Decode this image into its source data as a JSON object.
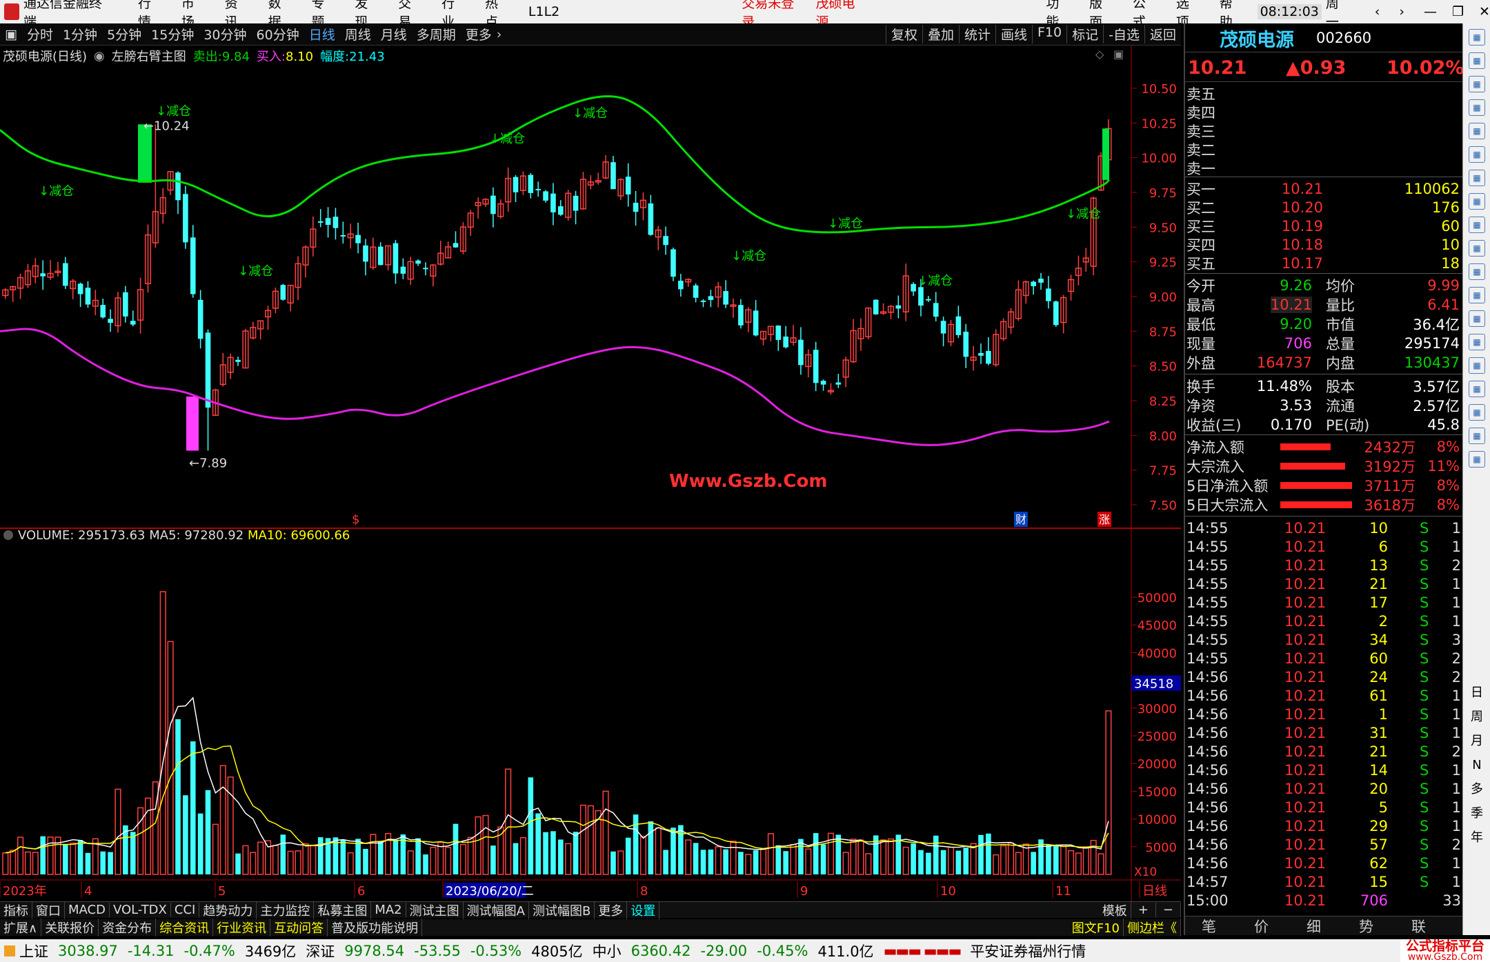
{
  "app": {
    "name": "通达信金融终端",
    "menus": [
      "行情",
      "市场",
      "资讯",
      "数据",
      "专题",
      "发现",
      "交易",
      "行业",
      "热点",
      "L1L2"
    ],
    "login": "交易未登录",
    "stock_title": "茂硕电源",
    "right_menus": [
      "功能",
      "版面",
      "公式",
      "选项",
      "帮助"
    ],
    "time": "08:12:03",
    "weekday": "周一"
  },
  "toolbar": {
    "periods": [
      "分时",
      "1分钟",
      "5分钟",
      "15分钟",
      "30分钟",
      "60分钟",
      "日线",
      "周线",
      "月线",
      "多周期",
      "更多"
    ],
    "selected": "日线",
    "right": [
      "复权",
      "叠加",
      "统计",
      "画线",
      "F10",
      "标记",
      "-自选",
      "返回"
    ]
  },
  "chart_info": {
    "stock": "茂硕电源(日线)",
    "main_indicator": "左膀右臂主图",
    "sell_label": "卖出:",
    "sell_value": "9.84",
    "buy_label": "买入:",
    "buy_value": "8.10",
    "range_label": "幅度:",
    "range_value": "21.43"
  },
  "price_axis": [
    "10.50",
    "10.25",
    "10.00",
    "9.75",
    "9.50",
    "9.25",
    "9.00",
    "8.75",
    "8.50",
    "8.25",
    "8.00",
    "7.75",
    "7.50"
  ],
  "price_annotations": {
    "high": "10.24",
    "low": "7.89",
    "reduce": "↓减仓",
    "watermark": "Www.Gszb.Com",
    "markers": [
      "$",
      "财",
      "涨"
    ]
  },
  "volume_info": {
    "label": "VOLUME: 295173.63",
    "ma5": "MA5: 97280.92",
    "ma10": "MA10: 69600.66",
    "cursor": "34518",
    "unit": "X10"
  },
  "volume_axis": [
    "50000",
    "45000",
    "40000",
    "35000",
    "30000",
    "25000",
    "20000",
    "15000",
    "10000",
    "5000"
  ],
  "date_axis": [
    "2023年",
    "4",
    "5",
    "6",
    "2023/06/20/二",
    "8",
    "9",
    "10",
    "11",
    "日线"
  ],
  "bottom_tabs": [
    "指标",
    "窗口",
    "MACD",
    "VOL-TDX",
    "CCI",
    "趋势动力",
    "主力监控",
    "私募主图",
    "MA2",
    "测试主图",
    "测试幅图A",
    "测试幅图B",
    "更多",
    "设置",
    "模板"
  ],
  "bottom_tabs2": [
    "扩展∧",
    "关联报价",
    "资金分布",
    "综合资讯",
    "行业资讯",
    "互动问答",
    "普及版功能说明"
  ],
  "bottom_right": [
    "图文F10",
    "侧边栏《"
  ],
  "quote": {
    "name": "茂硕电源",
    "code": "002660",
    "price": "10.21",
    "change": "▲0.93",
    "pct": "10.02%",
    "asks": [
      "卖五",
      "卖四",
      "卖三",
      "卖二",
      "卖一"
    ],
    "bids": [
      {
        "l": "买一",
        "p": "10.21",
        "v": "110062"
      },
      {
        "l": "买二",
        "p": "10.20",
        "v": "176"
      },
      {
        "l": "买三",
        "p": "10.19",
        "v": "60"
      },
      {
        "l": "买四",
        "p": "10.18",
        "v": "10"
      },
      {
        "l": "买五",
        "p": "10.17",
        "v": "18"
      }
    ],
    "stats": [
      [
        "今开",
        "9.26",
        "均价",
        "9.99"
      ],
      [
        "最高",
        "10.21",
        "量比",
        "6.41"
      ],
      [
        "最低",
        "9.20",
        "市值",
        "36.4亿"
      ],
      [
        "现量",
        "706",
        "总量",
        "295174"
      ],
      [
        "外盘",
        "164737",
        "内盘",
        "130437"
      ]
    ],
    "stats2": [
      [
        "换手",
        "11.48%",
        "股本",
        "3.57亿"
      ],
      [
        "净资",
        "3.53",
        "流通",
        "2.57亿"
      ],
      [
        "收益(三)",
        "0.170",
        "PE(动)",
        "45.8"
      ]
    ],
    "flows": [
      [
        "净流入额",
        "2432万",
        "8%"
      ],
      [
        "大宗流入",
        "3192万",
        "11%"
      ],
      [
        "5日净流入额",
        "3711万",
        "8%"
      ],
      [
        "5日大宗流入",
        "3618万",
        "8%"
      ]
    ],
    "ticks": [
      [
        "14:55",
        "10.21",
        "10",
        "S",
        "1"
      ],
      [
        "14:55",
        "10.21",
        "6",
        "S",
        "1"
      ],
      [
        "14:55",
        "10.21",
        "13",
        "S",
        "2"
      ],
      [
        "14:55",
        "10.21",
        "21",
        "S",
        "1"
      ],
      [
        "14:55",
        "10.21",
        "17",
        "S",
        "1"
      ],
      [
        "14:55",
        "10.21",
        "2",
        "S",
        "1"
      ],
      [
        "14:55",
        "10.21",
        "34",
        "S",
        "3"
      ],
      [
        "14:55",
        "10.21",
        "60",
        "S",
        "2"
      ],
      [
        "14:56",
        "10.21",
        "24",
        "S",
        "2"
      ],
      [
        "14:56",
        "10.21",
        "61",
        "S",
        "1"
      ],
      [
        "14:56",
        "10.21",
        "1",
        "S",
        "1"
      ],
      [
        "14:56",
        "10.21",
        "31",
        "S",
        "1"
      ],
      [
        "14:56",
        "10.21",
        "21",
        "S",
        "2"
      ],
      [
        "14:56",
        "10.21",
        "14",
        "S",
        "1"
      ],
      [
        "14:56",
        "10.21",
        "20",
        "S",
        "1"
      ],
      [
        "14:56",
        "10.21",
        "5",
        "S",
        "1"
      ],
      [
        "14:56",
        "10.21",
        "29",
        "S",
        "1"
      ],
      [
        "14:56",
        "10.21",
        "57",
        "S",
        "2"
      ],
      [
        "14:56",
        "10.21",
        "62",
        "S",
        "1"
      ],
      [
        "14:57",
        "10.21",
        "15",
        "S",
        "1"
      ],
      [
        "15:00",
        "10.21",
        "706",
        "",
        "33"
      ]
    ],
    "tabs": [
      "笔",
      "价",
      "细",
      "势",
      "联"
    ]
  },
  "side_icons": [
    "日",
    "周",
    "月",
    "N",
    "多",
    "季",
    "年"
  ],
  "status": {
    "sh_label": "上证",
    "sh": "3038.97",
    "sh_chg": "-14.31",
    "sh_pct": "-0.47%",
    "sh_amt": "3469亿",
    "sz_label": "深证",
    "sz": "9978.54",
    "sz_chg": "-53.55",
    "sz_pct": "-0.53%",
    "sz_amt": "4805亿",
    "zx_label": "中小",
    "zx": "6360.42",
    "zx_chg": "-29.00",
    "zx_pct": "-0.45%",
    "zx_amt": "411.0亿",
    "broker": "平安证券福州行情",
    "brand": "公式指标平台",
    "brand_url": "www.Gszb.Com"
  }
}
